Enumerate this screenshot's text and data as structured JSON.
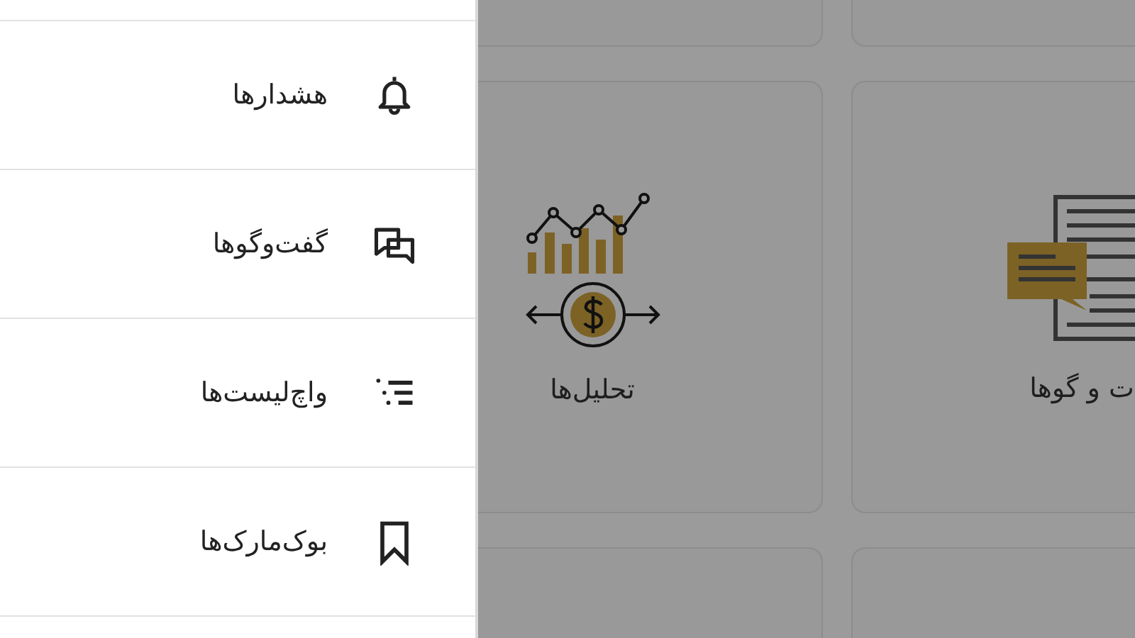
{
  "drawer": {
    "items": [
      {
        "label": "هشدارها",
        "kind": "bell"
      },
      {
        "label": "گفت‌وگوها",
        "kind": "chat"
      },
      {
        "label": "واچ‌لیست‌ها",
        "kind": "list"
      },
      {
        "label": "بوک‌مارک‌ها",
        "kind": "bookmark"
      }
    ]
  },
  "cards": [
    {
      "label": "ت و گوها",
      "kind": "chat"
    },
    {
      "label": "تحلیل‌ها",
      "kind": "analytics"
    }
  ]
}
